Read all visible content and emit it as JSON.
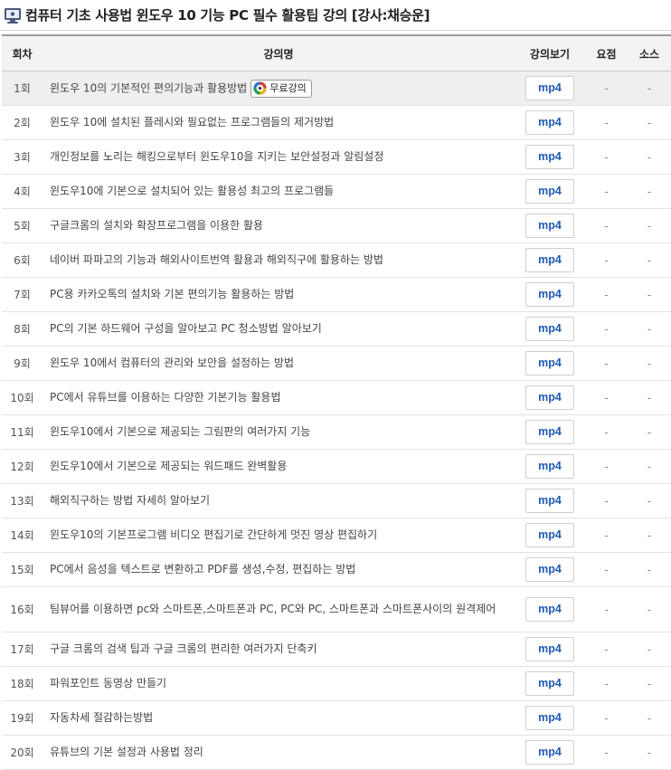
{
  "header": {
    "title": "컴퓨터 기초 사용법 윈도우 10 기능 PC 필수 활용팁 강의 [강사:채승운]"
  },
  "table": {
    "columns": {
      "num": "회차",
      "title": "강의명",
      "watch": "강의보기",
      "summary": "요점",
      "source": "소스"
    },
    "rows": [
      {
        "num": "1회",
        "title": "윈도우 10의 기본적인 편의기능과 활용방법",
        "video": "mp4",
        "summary": "-",
        "source": "-",
        "free": "무료강의"
      },
      {
        "num": "2회",
        "title": "윈도우 10에 설치된 플레시와 필요없는 프로그램들의 제거방법",
        "video": "mp4",
        "summary": "-",
        "source": "-"
      },
      {
        "num": "3회",
        "title": "개인정보를 노리는 해킹으로부터 윈도우10을 지키는 보안설정과 알림설정",
        "video": "mp4",
        "summary": "-",
        "source": "-"
      },
      {
        "num": "4회",
        "title": "윈도우10에 기본으로 설치되어 있는 활용성 최고의 프로그램들",
        "video": "mp4",
        "summary": "-",
        "source": "-"
      },
      {
        "num": "5회",
        "title": "구글크롬의 설치와 확장프로그램을 이용한 활용",
        "video": "mp4",
        "summary": "-",
        "source": "-"
      },
      {
        "num": "6회",
        "title": "네이버 파파고의 기능과 해외사이트번역 활용과 해외직구에 활용하는 방법",
        "video": "mp4",
        "summary": "-",
        "source": "-"
      },
      {
        "num": "7회",
        "title": "PC용 카카오톡의 설치와 기본 편의기능 활용하는 방법",
        "video": "mp4",
        "summary": "-",
        "source": "-"
      },
      {
        "num": "8회",
        "title": "PC의 기본 하드웨어 구성을 알아보고 PC 청소방법 알아보기",
        "video": "mp4",
        "summary": "-",
        "source": "-"
      },
      {
        "num": "9회",
        "title": "윈도우 10에서 컴퓨터의 관리와 보안을 설정하는 방법",
        "video": "mp4",
        "summary": "-",
        "source": "-"
      },
      {
        "num": "10회",
        "title": "PC에서 유튜브를 이용하는 다양한 기본기능 활용법",
        "video": "mp4",
        "summary": "-",
        "source": "-"
      },
      {
        "num": "11회",
        "title": "윈도우10에서 기본으로 제공되는 그림판의 여러가지 기능",
        "video": "mp4",
        "summary": "-",
        "source": "-"
      },
      {
        "num": "12회",
        "title": "윈도우10에서 기본으로 제공되는 워드패드 완벽활용",
        "video": "mp4",
        "summary": "-",
        "source": "-"
      },
      {
        "num": "13회",
        "title": "해외직구하는 방법 자세히 알아보기",
        "video": "mp4",
        "summary": "-",
        "source": "-"
      },
      {
        "num": "14회",
        "title": "윈도우10의 기본프로그램 비디오 편집기로 간단하게 멋진 영상 편집하기",
        "video": "mp4",
        "summary": "-",
        "source": "-"
      },
      {
        "num": "15회",
        "title": "PC에서 음성을 텍스트로 변환하고 PDF를 생성,수정, 편집하는 방법",
        "video": "mp4",
        "summary": "-",
        "source": "-"
      },
      {
        "num": "16회",
        "title": "팀뷰어를 이용하면 pc와 스마트폰,스마트폰과 PC, PC와 PC, 스마트폰과 스마트폰사이의 원격제어",
        "video": "mp4",
        "summary": "-",
        "source": "-"
      },
      {
        "num": "17회",
        "title": "구글 크롬의 검색 팁과 구글 크롬의 편리한 여러가지 단축키",
        "video": "mp4",
        "summary": "-",
        "source": "-"
      },
      {
        "num": "18회",
        "title": "파워포인트 동영상 만들기",
        "video": "mp4",
        "summary": "-",
        "source": "-"
      },
      {
        "num": "19회",
        "title": "자동차세 절감하는방법",
        "video": "mp4",
        "summary": "-",
        "source": "-"
      },
      {
        "num": "20회",
        "title": "유튜브의 기본 설정과 사용법 정리",
        "video": "mp4",
        "summary": "-",
        "source": "-"
      }
    ]
  }
}
